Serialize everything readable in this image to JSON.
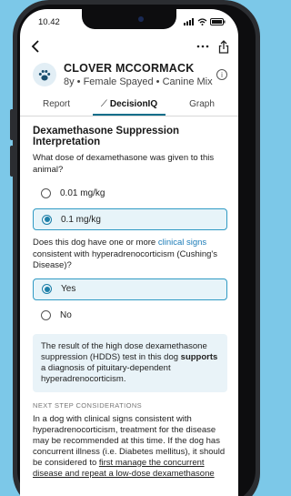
{
  "status": {
    "time": "10.42"
  },
  "patient": {
    "name": "CLOVER MCCORMACK",
    "details": "8y • Female Spayed • Canine Mix"
  },
  "tabs": [
    {
      "label": "Report"
    },
    {
      "label": "DecisionIQ",
      "active": true
    },
    {
      "label": "Graph"
    }
  ],
  "main": {
    "title": "Dexamethasone Suppression Interpretation",
    "q1": "What dose of dexamethasone was given to this animal?",
    "q1_options": [
      {
        "label": "0.01 mg/kg",
        "selected": false
      },
      {
        "label": "0.1 mg/kg",
        "selected": true
      }
    ],
    "q2_pre": "Does this dog have one or more ",
    "q2_link": "clinical signs",
    "q2_post": " consistent with hyperadrenocorticism (Cushing's Disease)?",
    "q2_options": [
      {
        "label": "Yes",
        "selected": true
      },
      {
        "label": "No",
        "selected": false
      }
    ],
    "result_pre": "The result of the high dose dexamethasone suppression (HDDS) test in this dog ",
    "result_bold": "supports",
    "result_post": " a diagnosis of pituitary-dependent hyperadrenocorticism.",
    "next_title": "NEXT STEP CONSIDERATIONS",
    "next_pre": "In a dog with clinical signs consistent with hyperadrenocorticism, treatment for the disease may be recommended at this time. If the dog has concurrent illness (i.e. Diabetes mellitus), it should be considered to ",
    "next_underline": "first manage the concurrent disease and repeat a low-dose dexamethasone"
  },
  "icons": {
    "back": "chevron-left-icon",
    "more": "more-horizontal-icon",
    "share": "share-icon",
    "avatar": "dog-paw-icon",
    "info": "info-icon",
    "decision": "wand-icon"
  },
  "colors": {
    "accent": "#1d7fa8",
    "selected_bg": "#e7f4f9",
    "link": "#1c7cb8",
    "background": "#7cc8e8"
  }
}
